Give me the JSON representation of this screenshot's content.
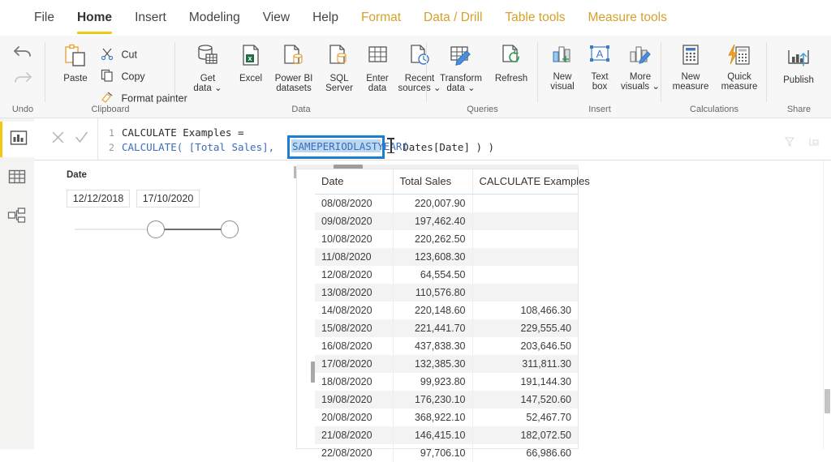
{
  "ribbon": {
    "tabs": [
      {
        "label": "File",
        "active": false,
        "contextual": false
      },
      {
        "label": "Home",
        "active": true,
        "contextual": false
      },
      {
        "label": "Insert",
        "active": false,
        "contextual": false
      },
      {
        "label": "Modeling",
        "active": false,
        "contextual": false
      },
      {
        "label": "View",
        "active": false,
        "contextual": false
      },
      {
        "label": "Help",
        "active": false,
        "contextual": false
      },
      {
        "label": "Format",
        "active": false,
        "contextual": true
      },
      {
        "label": "Data / Drill",
        "active": false,
        "contextual": true
      },
      {
        "label": "Table tools",
        "active": false,
        "contextual": true
      },
      {
        "label": "Measure tools",
        "active": false,
        "contextual": true
      }
    ],
    "groups": {
      "undo": {
        "label": "Undo"
      },
      "clipboard": {
        "label": "Clipboard"
      },
      "data": {
        "label": "Data"
      },
      "queries": {
        "label": "Queries"
      },
      "insert": {
        "label": "Insert"
      },
      "calculations": {
        "label": "Calculations"
      },
      "share": {
        "label": "Share"
      }
    },
    "buttons": {
      "undo": {
        "label": "",
        "icon": "undo-arrow-icon"
      },
      "redo": {
        "label": "",
        "icon": "redo-arrow-icon"
      },
      "paste": {
        "label": "Paste",
        "icon": "clipboard-icon"
      },
      "cut": {
        "label": "Cut",
        "icon": "scissors-icon"
      },
      "copy": {
        "label": "Copy",
        "icon": "copy-pages-icon"
      },
      "format_painter": {
        "label": "Format painter",
        "icon": "paintbrush-icon"
      },
      "get_data": {
        "label": "Get",
        "label2": "data",
        "icon": "database-table-icon"
      },
      "excel": {
        "label": "Excel",
        "label2": "",
        "icon": "excel-file-icon"
      },
      "powerbi_datasets": {
        "label": "Power BI",
        "label2": "datasets",
        "icon": "powerbi-dataset-icon"
      },
      "sql_server": {
        "label": "SQL",
        "label2": "Server",
        "icon": "sql-server-icon"
      },
      "enter_data": {
        "label": "Enter",
        "label2": "data",
        "icon": "grid-table-icon"
      },
      "recent_sources": {
        "label": "Recent",
        "label2": "sources",
        "icon": "recent-clock-icon"
      },
      "transform_data": {
        "label": "Transform",
        "label2": "data",
        "icon": "transform-pencil-icon"
      },
      "refresh": {
        "label": "Refresh",
        "label2": "",
        "icon": "refresh-circular-icon"
      },
      "new_visual": {
        "label": "New",
        "label2": "visual",
        "icon": "new-visual-icon"
      },
      "text_box": {
        "label": "Text",
        "label2": "box",
        "icon": "text-box-icon"
      },
      "more_visuals": {
        "label": "More",
        "label2": "visuals",
        "icon": "more-visuals-icon"
      },
      "new_measure": {
        "label": "New",
        "label2": "measure",
        "icon": "calculator-icon"
      },
      "quick_measure": {
        "label": "Quick",
        "label2": "measure",
        "icon": "quick-measure-icon"
      },
      "publish": {
        "label": "Publish",
        "label2": "",
        "icon": "publish-icon"
      }
    }
  },
  "left_rail": {
    "items": [
      {
        "name": "report-view",
        "icon": "report-bar-chart-icon",
        "active": true
      },
      {
        "name": "data-view",
        "icon": "data-grid-icon",
        "active": false
      },
      {
        "name": "model-view",
        "icon": "model-relationship-icon",
        "active": false
      }
    ]
  },
  "formula_bar": {
    "cancel_icon": "cancel-x-icon",
    "commit_icon": "commit-check-icon",
    "line1": {
      "number": "1",
      "text": "CALCULATE Examples ="
    },
    "line2": {
      "number": "2",
      "prefix": "CALCULATE( [Total Sales], ",
      "selected_token": "SAMEPERIODLASTYEAR(",
      "suffix": " Dates[Date] ) )"
    },
    "selection_border_color": "#1a7fd4",
    "selection_fill_color": "#bcd8f0",
    "right_icons": [
      {
        "name": "filter-funnel-icon"
      },
      {
        "name": "expand-editor-icon"
      }
    ]
  },
  "slicer": {
    "title": "Date",
    "start_value": "12/12/2018",
    "end_value": "17/10/2020"
  },
  "table": {
    "columns": [
      "Date",
      "Total Sales",
      "CALCULATE Examples"
    ],
    "rows": [
      {
        "date": "08/08/2020",
        "total_sales": "220,007.90",
        "calculate": ""
      },
      {
        "date": "09/08/2020",
        "total_sales": "197,462.40",
        "calculate": ""
      },
      {
        "date": "10/08/2020",
        "total_sales": "220,262.50",
        "calculate": ""
      },
      {
        "date": "11/08/2020",
        "total_sales": "123,608.30",
        "calculate": ""
      },
      {
        "date": "12/08/2020",
        "total_sales": "64,554.50",
        "calculate": ""
      },
      {
        "date": "13/08/2020",
        "total_sales": "110,576.80",
        "calculate": ""
      },
      {
        "date": "14/08/2020",
        "total_sales": "220,148.60",
        "calculate": "108,466.30"
      },
      {
        "date": "15/08/2020",
        "total_sales": "221,441.70",
        "calculate": "229,555.40"
      },
      {
        "date": "16/08/2020",
        "total_sales": "437,838.30",
        "calculate": "203,646.50"
      },
      {
        "date": "17/08/2020",
        "total_sales": "132,385.30",
        "calculate": "311,811.30"
      },
      {
        "date": "18/08/2020",
        "total_sales": "99,923.80",
        "calculate": "191,144.30"
      },
      {
        "date": "19/08/2020",
        "total_sales": "176,230.10",
        "calculate": "147,520.60"
      },
      {
        "date": "20/08/2020",
        "total_sales": "368,922.10",
        "calculate": "52,467.70"
      },
      {
        "date": "21/08/2020",
        "total_sales": "146,415.10",
        "calculate": "182,072.50"
      },
      {
        "date": "22/08/2020",
        "total_sales": "97,706.10",
        "calculate": "66,986.60"
      }
    ]
  },
  "colors": {
    "accent_yellow": "#f2c811",
    "contextual_tab": "#d4a12a",
    "selection_blue": "#1a7fd4",
    "ribbon_bg": "#f7f7f7",
    "rail_bg": "#f3f3f2"
  }
}
